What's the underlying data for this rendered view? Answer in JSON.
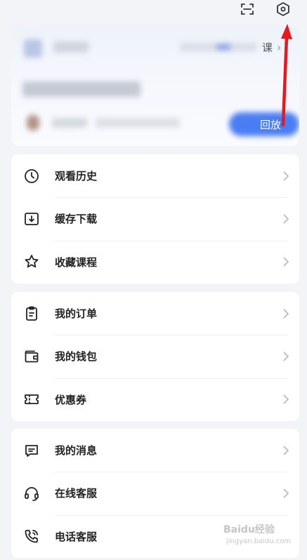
{
  "header": {
    "scan_icon": "scan-icon",
    "settings_icon": "settings-hexagon-icon"
  },
  "recent_course": {
    "more_text": "课",
    "replay_text": "回放"
  },
  "groups": [
    {
      "items": [
        {
          "label": "观看历史",
          "icon": "clock-icon"
        },
        {
          "label": "缓存下载",
          "icon": "download-icon"
        },
        {
          "label": "收藏课程",
          "icon": "star-icon"
        }
      ]
    },
    {
      "items": [
        {
          "label": "我的订单",
          "icon": "clipboard-icon"
        },
        {
          "label": "我的钱包",
          "icon": "wallet-icon"
        },
        {
          "label": "优惠券",
          "icon": "ticket-icon"
        }
      ]
    },
    {
      "items": [
        {
          "label": "我的消息",
          "icon": "message-icon"
        },
        {
          "label": "在线客服",
          "icon": "headset-icon"
        },
        {
          "label": "电话客服",
          "icon": "phone-icon"
        }
      ]
    }
  ],
  "watermark": {
    "brand": "Baidu经验",
    "url": "jingyan.baidu.com"
  },
  "colors": {
    "accent": "#4a7cf3",
    "annotation": "#e8191c",
    "page_bg": "#f2f4f8"
  }
}
